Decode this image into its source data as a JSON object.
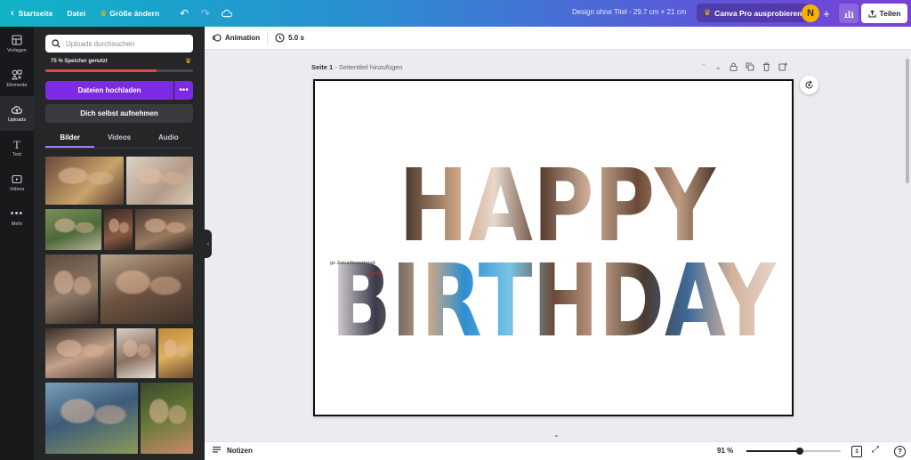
{
  "topbar": {
    "back_label": "Startseite",
    "file_label": "Datei",
    "resize_label": "Größe ändern",
    "design_title": "Design ohne Titel - 29.7 cm × 21 cm",
    "pro_label": "Canva Pro ausprobieren",
    "avatar_initial": "N",
    "share_label": "Teilen"
  },
  "rail": {
    "items": [
      {
        "label": "Vorlagen",
        "icon": "template-icon"
      },
      {
        "label": "Elemente",
        "icon": "elements-icon"
      },
      {
        "label": "Uploads",
        "icon": "upload-cloud-icon",
        "active": true
      },
      {
        "label": "Text",
        "icon": "text-icon"
      },
      {
        "label": "Videos",
        "icon": "video-icon"
      },
      {
        "label": "Mehr",
        "icon": "more-icon"
      }
    ]
  },
  "panel": {
    "search_placeholder": "Uploads durchsuchen",
    "storage_label": "75 % Speicher genutzt",
    "storage_fraction": 0.75,
    "upload_label": "Dateien hochladen",
    "record_label": "Dich selbst aufnehmen",
    "tabs": [
      {
        "label": "Bilder",
        "active": true
      },
      {
        "label": "Videos"
      },
      {
        "label": "Audio"
      }
    ]
  },
  "editor": {
    "animation_label": "Animation",
    "duration_label": "5.0 s"
  },
  "page": {
    "page_label": "Seite 1",
    "page_title_placeholder": "Seitentitel hinzufügen",
    "line1": "HAPPY",
    "line2": "BIRTHDAY",
    "embedded_photo_text_1": "ge Zukunftswerkstatt",
    "embedded_photo_text_2": "COMPA"
  },
  "bottombar": {
    "notes_label": "Notizen",
    "zoom_label": "91 %",
    "zoom_fraction": 0.57,
    "page_count": "3"
  },
  "colors": {
    "accent": "#7d2ae8",
    "storage_bar": "#e1473e",
    "avatar": "#f5b300"
  }
}
